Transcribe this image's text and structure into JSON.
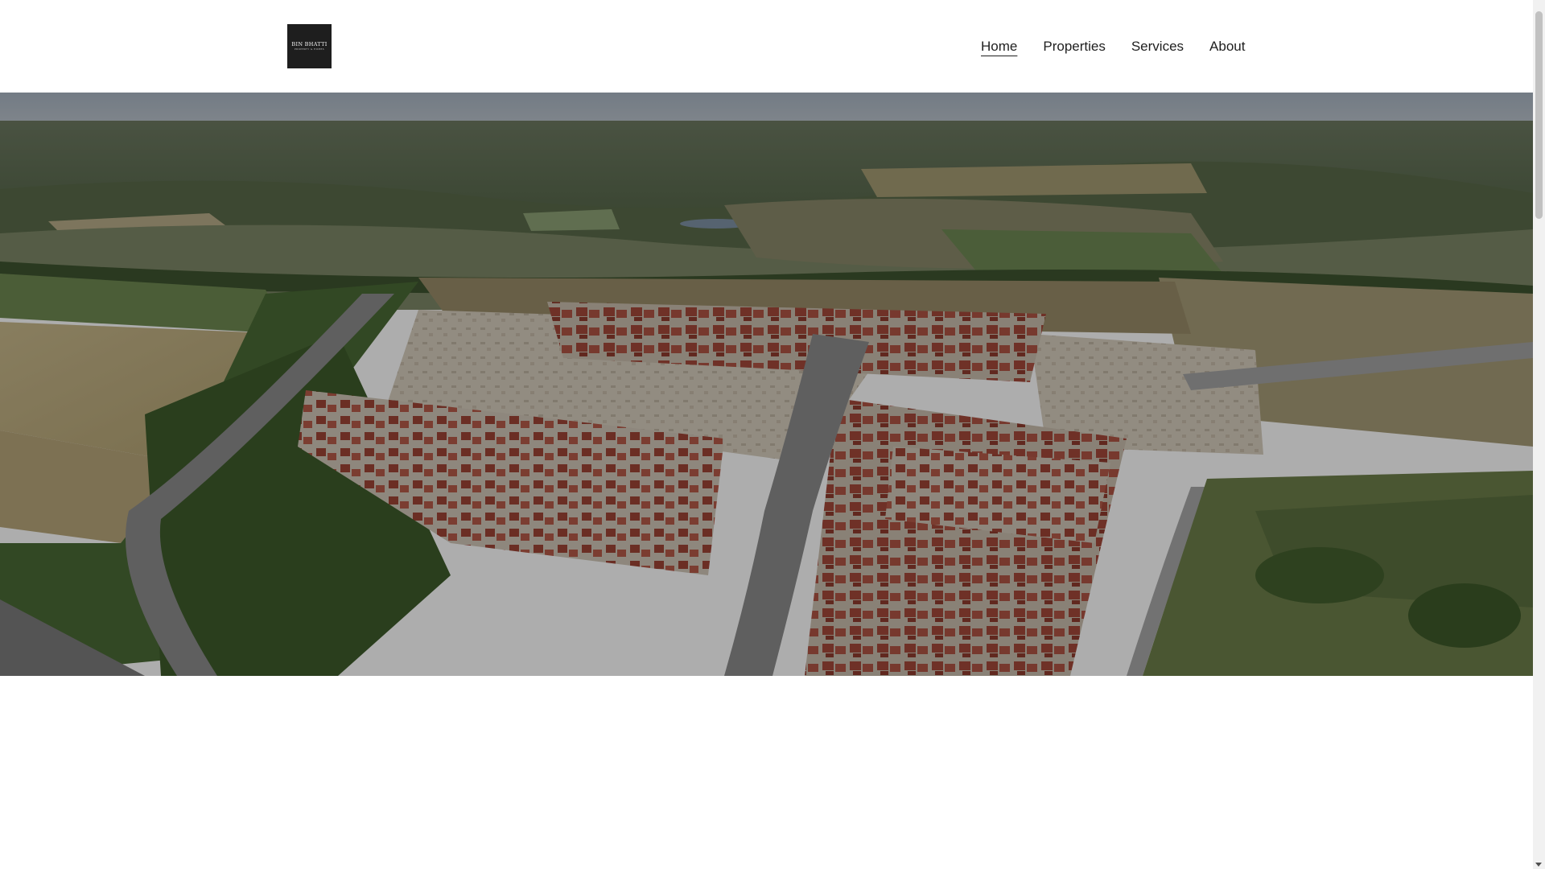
{
  "header": {
    "logo": {
      "title": "BIN BHATTI",
      "subtitle": "PROPERTY & HOMES",
      "icon": "logo-icon"
    },
    "nav": [
      {
        "label": "Home",
        "active": true
      },
      {
        "label": "Properties",
        "active": false
      },
      {
        "label": "Services",
        "active": false
      },
      {
        "label": "About",
        "active": false
      }
    ]
  },
  "hero": {
    "image": "aerial-housing-development-image"
  },
  "colors": {
    "background": "#ffffff",
    "text": "#1f1f1f",
    "logo_bg": "#1e1e1e",
    "scrollbar_track": "#f1f1f1",
    "scrollbar_thumb": "#c1c1c1"
  }
}
